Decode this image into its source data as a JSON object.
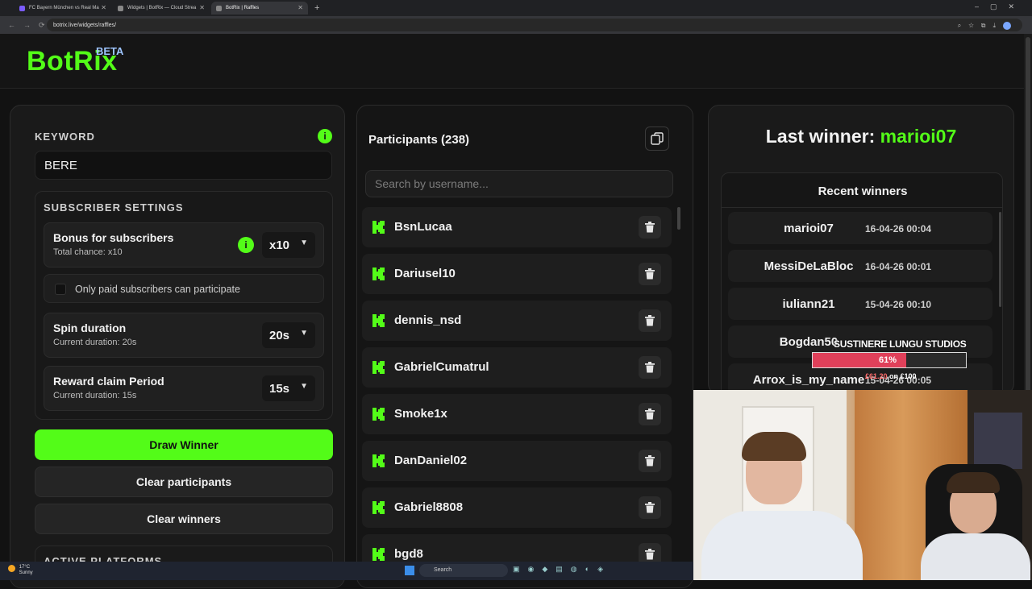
{
  "browser": {
    "tabs": [
      {
        "label": "FC Bayern München vs Real Ma",
        "color": "#7b5cff",
        "active": false
      },
      {
        "label": "Widgets | BotRix — Cloud Strea",
        "color": "#888888",
        "active": false
      },
      {
        "label": "BotRix | Raffles",
        "color": "#888888",
        "active": true
      }
    ],
    "url": "botrix.live/widgets/raffles/"
  },
  "header": {
    "logo": "BotRix",
    "badge": "BETA",
    "brand_color": "#53fc18"
  },
  "settings": {
    "keyword_label": "KEYWORD",
    "keyword_value": "BERE",
    "info_icon_text": "i",
    "subscriber_title": "SUBSCRIBER SETTINGS",
    "bonus": {
      "title": "Bonus for subscribers",
      "subtitle": "Total chance: x10",
      "value": "x10"
    },
    "paid_only": {
      "label": "Only paid subscribers can participate",
      "checked": false
    },
    "spin": {
      "title": "Spin duration",
      "subtitle": "Current duration: 20s",
      "value": "20s"
    },
    "reward": {
      "title": "Reward claim Period",
      "subtitle": "Current duration: 15s",
      "value": "15s"
    },
    "draw_button": "Draw Winner",
    "clear_participants_button": "Clear participants",
    "clear_winners_button": "Clear winners",
    "active_platforms_title": "ACTIVE PLATFORMS"
  },
  "participants": {
    "title": "Participants (238)",
    "search_placeholder": "Search by username...",
    "items": [
      {
        "name": "BsnLucaa"
      },
      {
        "name": "Dariusel10"
      },
      {
        "name": "dennis_nsd"
      },
      {
        "name": "GabrielCumatrul"
      },
      {
        "name": "Smoke1x"
      },
      {
        "name": "DanDaniel02"
      },
      {
        "name": "Gabriel8808"
      },
      {
        "name": "bgd8"
      }
    ]
  },
  "winners": {
    "last_winner_label": "Last winner:",
    "last_winner_name": "marioi07",
    "recent_title": "Recent winners",
    "items": [
      {
        "name": "marioi07",
        "date": "16-04-26 00:04"
      },
      {
        "name": "MessiDeLaBloc",
        "date": "16-04-26 00:01"
      },
      {
        "name": "iuliann21",
        "date": "15-04-26 00:10"
      },
      {
        "name": "Bogdan50",
        "date": ""
      },
      {
        "name": "Arrox_is_my_name",
        "date": "15-04-26 00:05"
      }
    ]
  },
  "overlay": {
    "title": "SUSTINERE LUNGU STUDIOS",
    "percent_label": "61%",
    "progress": 0.61,
    "raised": "£61.20",
    "goal_text": "on £100"
  },
  "taskbar": {
    "temp": "17°C",
    "weather": "Sunny",
    "search": "Search"
  }
}
